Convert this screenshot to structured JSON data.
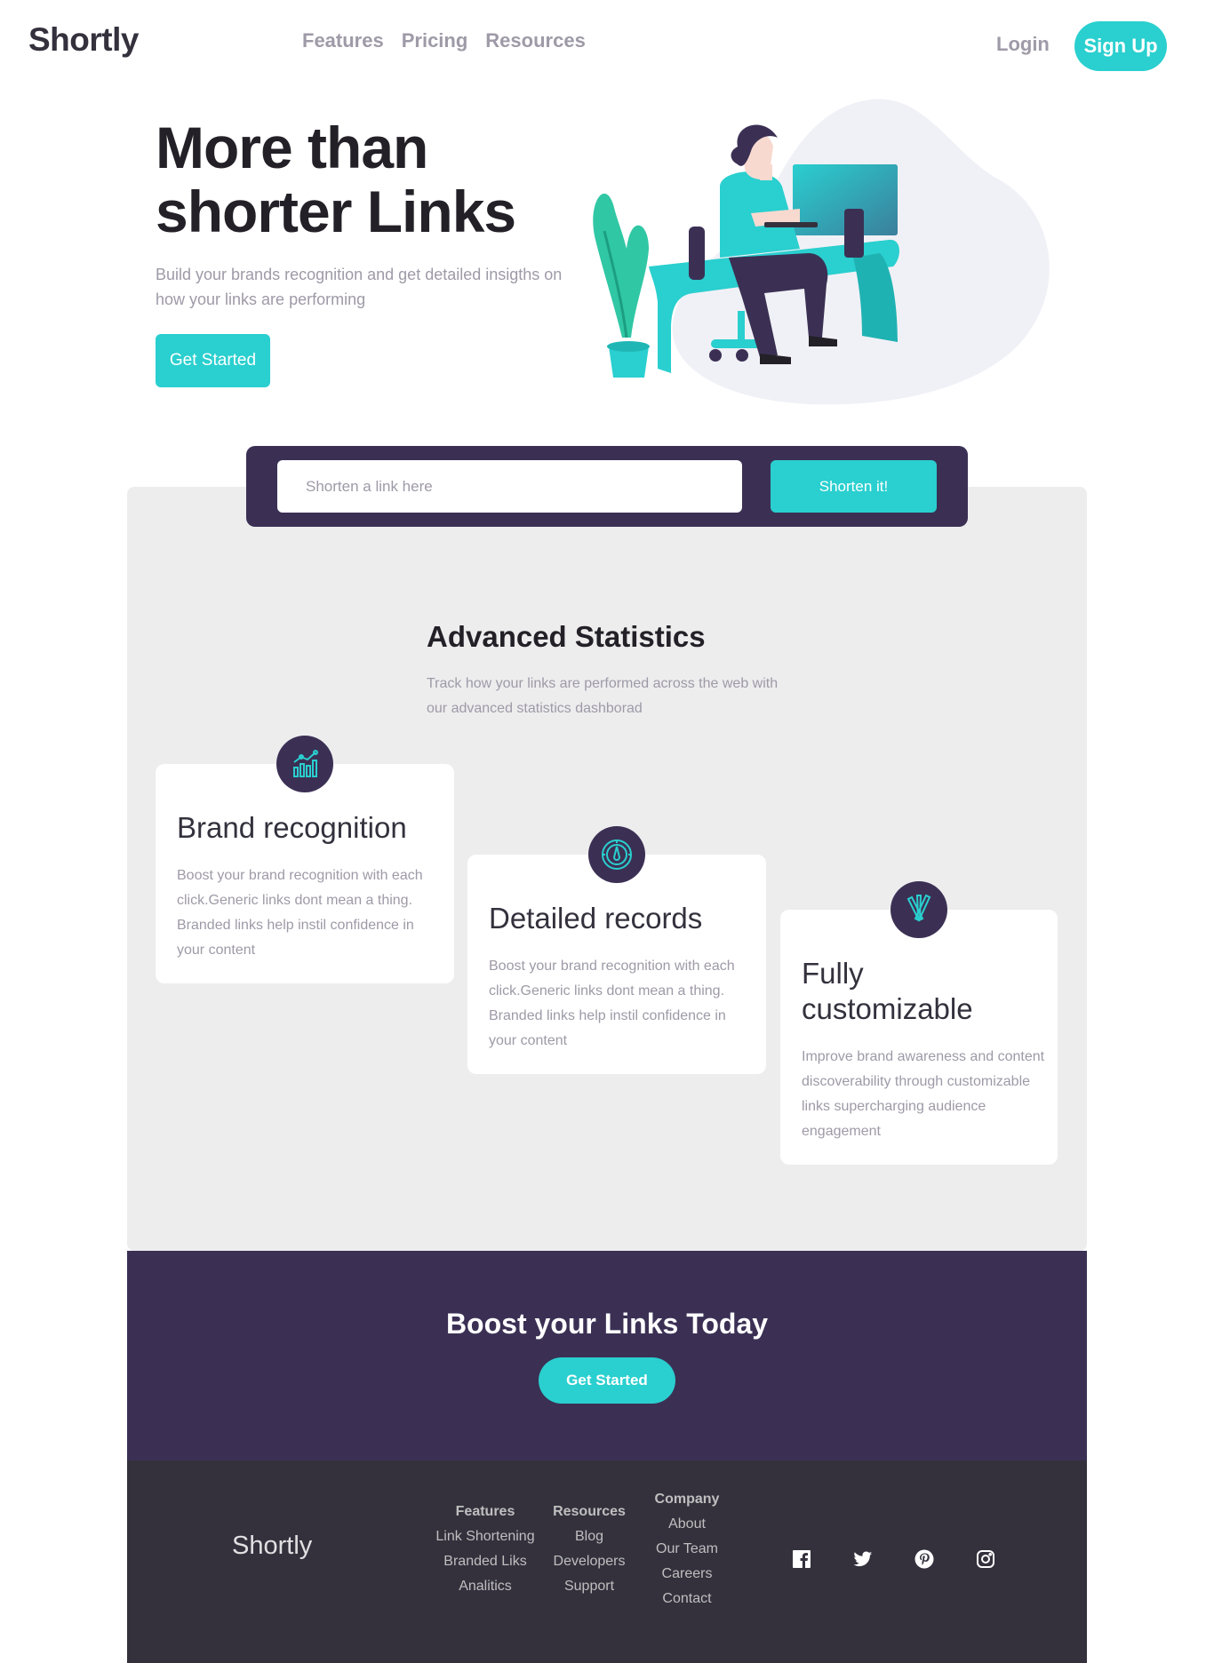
{
  "header": {
    "logo": "Shortly",
    "nav": [
      "Features",
      "Pricing",
      "Resources"
    ],
    "login": "Login",
    "signup": "Sign Up"
  },
  "hero": {
    "title": "More than shorter Links",
    "subtitle": "Build your brands recognition and get detailed insigths on how your links are performing",
    "cta": "Get Started"
  },
  "shorten": {
    "placeholder": "Shorten a link here",
    "button": "Shorten it!"
  },
  "stats": {
    "title": "Advanced Statistics",
    "subtitle": "Track how your links are performed across the web with our advanced statistics dashborad",
    "cards": [
      {
        "title": "Brand recognition",
        "text": "Boost your brand recognition with each click.Generic links dont mean a thing. Branded links help instil confidence in your content",
        "icon": "bar-chart-icon"
      },
      {
        "title": "Detailed records",
        "text": "Boost your brand recognition with each click.Generic links dont mean a thing. Branded links help instil confidence in your content",
        "icon": "gauge-icon"
      },
      {
        "title": "Fully customizable",
        "text": "Improve brand awareness and content discoverability through customizable links supercharging audience engagement",
        "icon": "tools-icon"
      }
    ]
  },
  "cta": {
    "title": "Boost your Links Today",
    "button": "Get Started"
  },
  "footer": {
    "logo": "Shortly",
    "columns": [
      {
        "head": "Features",
        "links": [
          "Link Shortening",
          "Branded Liks",
          "Analitics"
        ]
      },
      {
        "head": "Resources",
        "links": [
          "Blog",
          "Developers",
          "Support"
        ]
      },
      {
        "head": "Company",
        "links": [
          "About",
          "Our Team",
          "Careers",
          "Contact"
        ]
      }
    ],
    "socials": [
      "facebook-icon",
      "twitter-icon",
      "pinterest-icon",
      "instagram-icon"
    ]
  },
  "colors": {
    "accent": "#2acfcf",
    "dark_violet": "#3b3054",
    "footer_bg": "#34313d",
    "panel_bg": "#ededee",
    "grey_text": "#9e9aa7"
  }
}
